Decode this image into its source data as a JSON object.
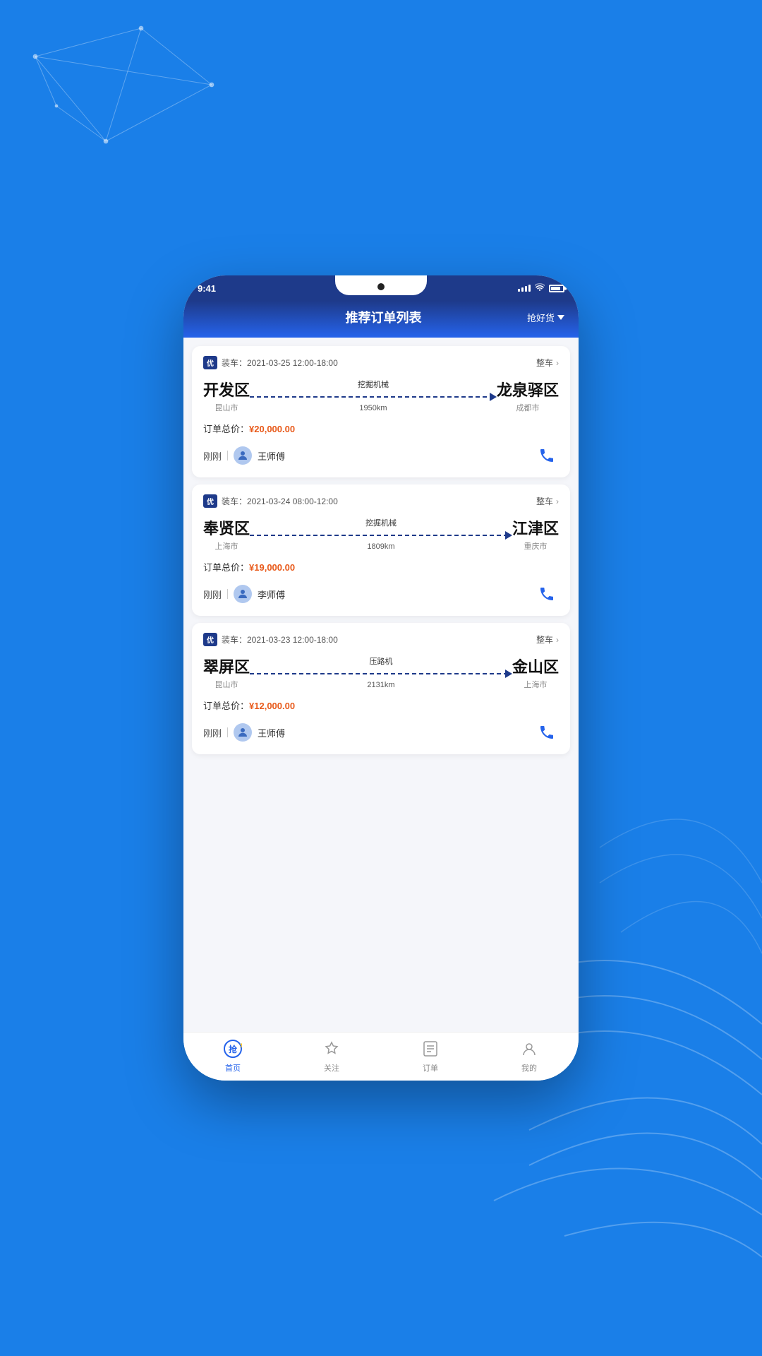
{
  "background": "#1a7fe8",
  "status_bar": {
    "time": "9:41"
  },
  "header": {
    "title": "推荐订单列表",
    "filter_label": "抢好货"
  },
  "orders": [
    {
      "badge": "优",
      "date": "装车：2021-03-25 12:00-18:00",
      "type": "整车",
      "from_city": "开发区",
      "from_sub": "昆山市",
      "cargo": "挖掘机械",
      "distance": "1950km",
      "to_city": "龙泉驿区",
      "to_sub": "成都市",
      "price_label": "订单总价：",
      "price": "¥20,000.00",
      "time_ago": "刚刚",
      "driver_name": "王师傅"
    },
    {
      "badge": "优",
      "date": "装车：2021-03-24 08:00-12:00",
      "type": "整车",
      "from_city": "奉贤区",
      "from_sub": "上海市",
      "cargo": "挖掘机械",
      "distance": "1809km",
      "to_city": "江津区",
      "to_sub": "重庆市",
      "price_label": "订单总价：",
      "price": "¥19,000.00",
      "time_ago": "刚刚",
      "driver_name": "李师傅"
    },
    {
      "badge": "优",
      "date": "装车：2021-03-23 12:00-18:00",
      "type": "整车",
      "from_city": "翠屏区",
      "from_sub": "昆山市",
      "cargo": "压路机",
      "distance": "2131km",
      "to_city": "金山区",
      "to_sub": "上海市",
      "price_label": "订单总价：",
      "price": "¥12,000.00",
      "time_ago": "刚刚",
      "driver_name": "王师傅"
    }
  ],
  "nav": {
    "items": [
      {
        "label": "首页",
        "icon": "home-icon",
        "active": true
      },
      {
        "label": "关注",
        "icon": "star-icon",
        "active": false
      },
      {
        "label": "订单",
        "icon": "list-icon",
        "active": false
      },
      {
        "label": "我的",
        "icon": "user-icon",
        "active": false
      }
    ]
  }
}
